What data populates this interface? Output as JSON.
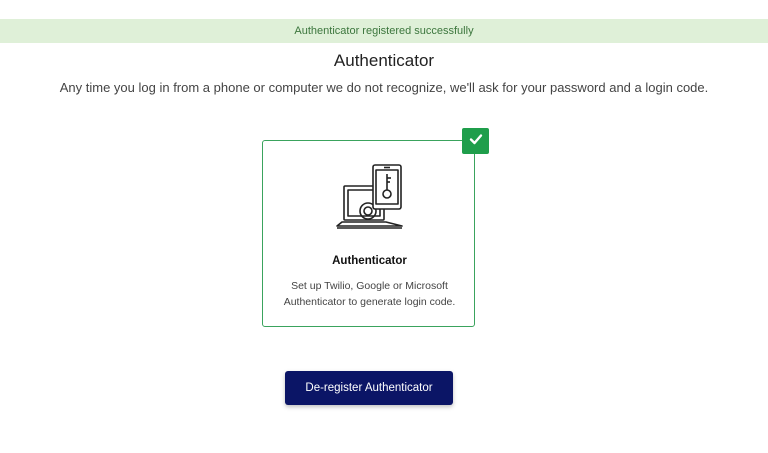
{
  "banner": {
    "text": "Authenticator registered successfully"
  },
  "header": {
    "title": "Authenticator",
    "description": "Any time you log in from a phone or computer we do not recognize, we'll ask for your password and a login code."
  },
  "card": {
    "icon": "laptop-phone-key-icon",
    "selected_icon": "check-icon",
    "title": "Authenticator",
    "description_line1": "Set up Twilio, Google or Microsoft",
    "description_line2": "Authenticator to generate login code."
  },
  "actions": {
    "deregister_label": "De-register Authenticator"
  },
  "colors": {
    "banner_bg": "#dff0d8",
    "banner_text": "#3c763d",
    "card_border": "#3aa35d",
    "check_badge": "#1f9e4b",
    "button_bg": "#0b1566"
  }
}
